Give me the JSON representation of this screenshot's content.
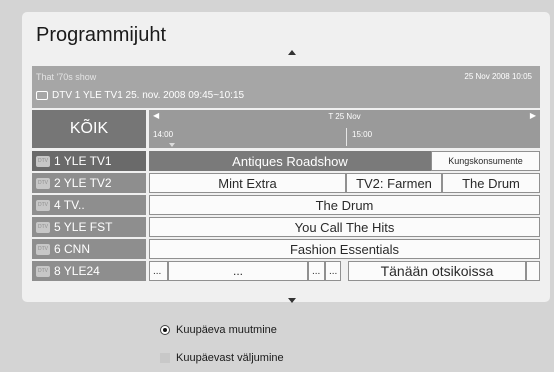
{
  "page_title": "Programmijuht",
  "info": {
    "show_name": "That '70s show",
    "datetime": "25 Nov 2008 10:05",
    "channel_line": "DTV 1 YLE TV1 25. nov. 2008 09:45~10:15"
  },
  "timebar": {
    "all_label": "KÕIK",
    "date": "T 25 Nov",
    "prev_arrow": "◀",
    "next_arrow": "▶",
    "time_1": "14:00",
    "time_2": "15:00"
  },
  "rows": [
    {
      "channel": "1 YLE TV1",
      "badge": "DTV",
      "programs": [
        "Antiques Roadshow",
        "Kungskonsumente"
      ]
    },
    {
      "channel": "2 YLE TV2",
      "badge": "DTV",
      "programs": [
        "Mint Extra",
        "TV2: Farmen",
        "The Drum"
      ]
    },
    {
      "channel": "4 TV..",
      "badge": "DTV",
      "programs": [
        "The Drum"
      ]
    },
    {
      "channel": "5 YLE FST",
      "badge": "DTV",
      "programs": [
        "You Call The Hits"
      ]
    },
    {
      "channel": "6 CNN",
      "badge": "DTV",
      "programs": [
        "Fashion Essentials"
      ]
    },
    {
      "channel": "8 YLE24",
      "badge": "DTV",
      "programs": [
        "...",
        "...",
        "...",
        "...",
        "Tänään otsikoissa",
        ""
      ]
    }
  ],
  "menu": {
    "change_date": "Kuupäeva muutmine",
    "exit_date": "Kuupäevast väljumine"
  }
}
